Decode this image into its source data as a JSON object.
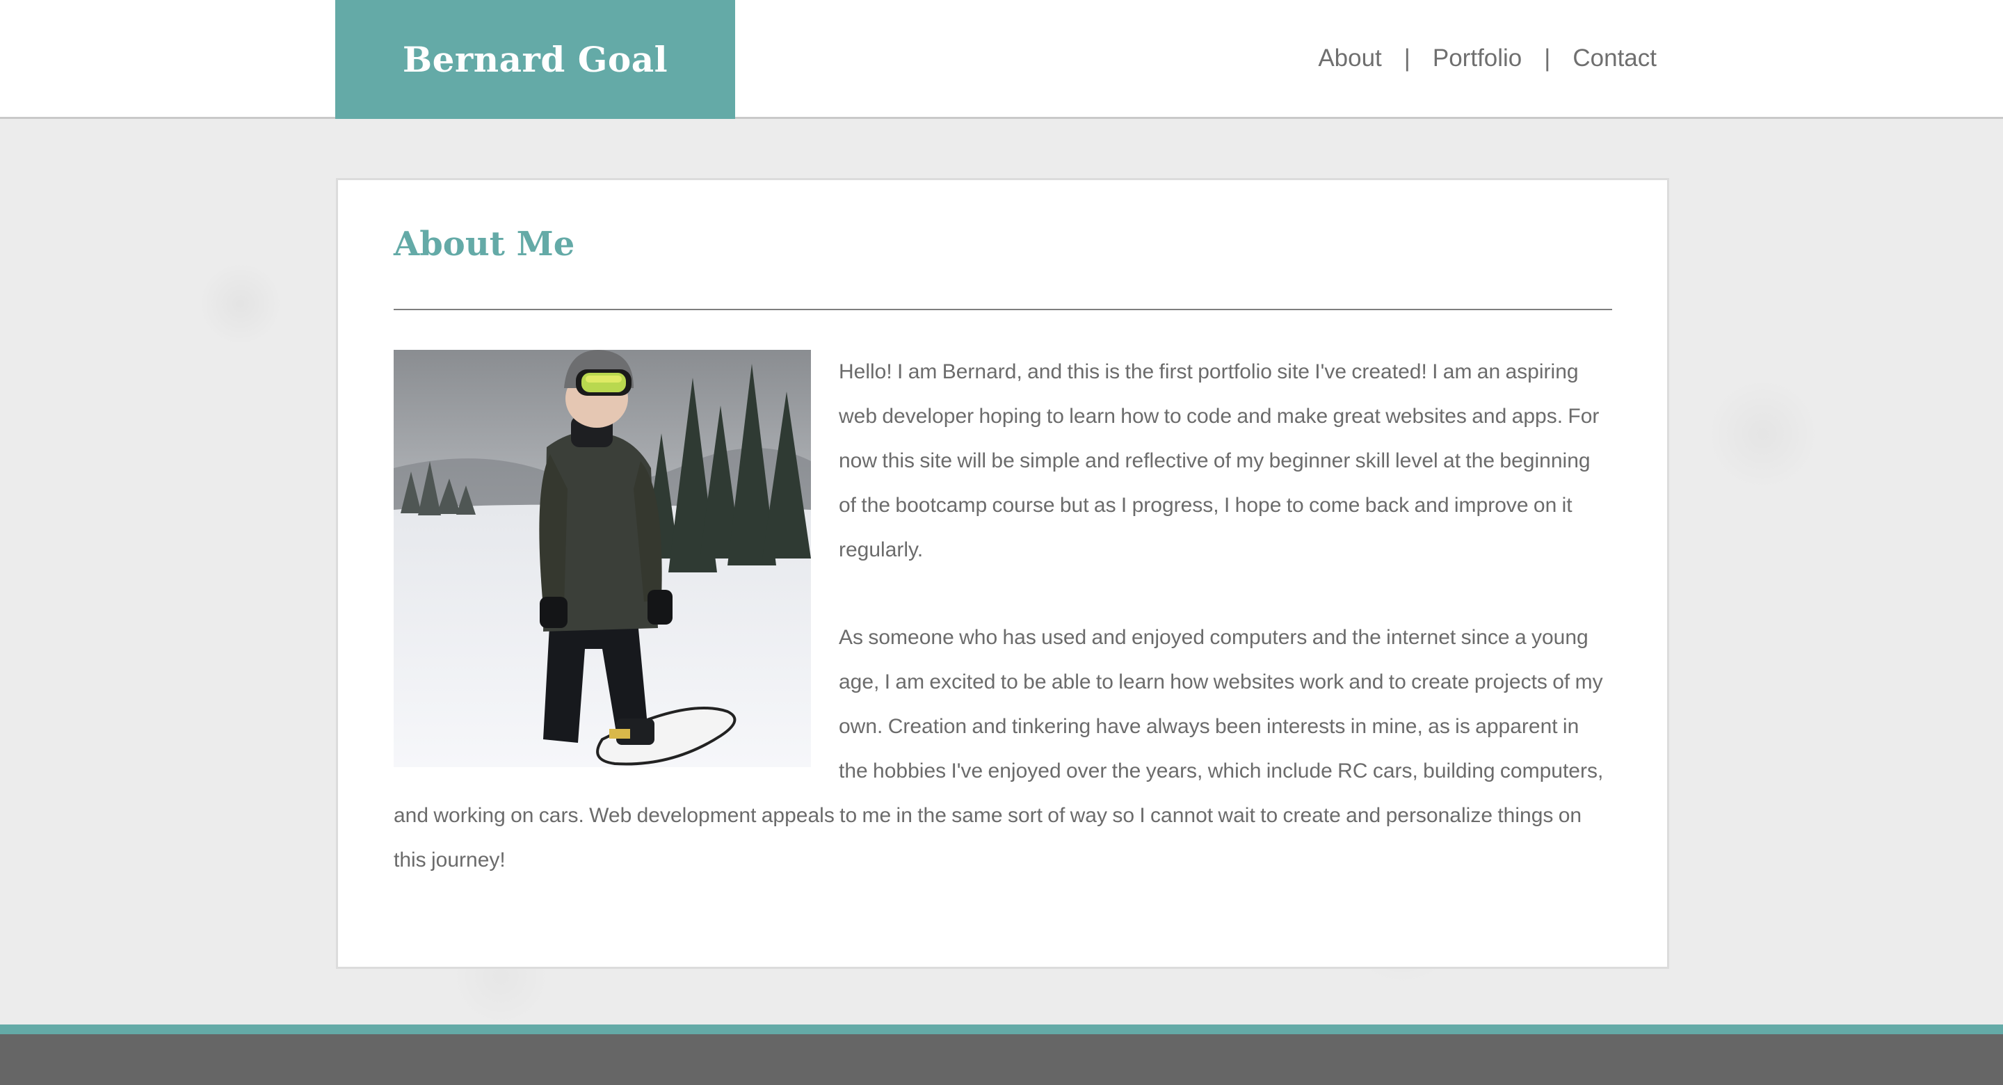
{
  "header": {
    "brand": "Bernard Goal",
    "nav": {
      "about": "About",
      "portfolio": "Portfolio",
      "contact": "Contact",
      "separator": "|"
    }
  },
  "main": {
    "title": "About Me",
    "photo_alt": "Bernard snowboarding on a snowy slope",
    "paragraphs": [
      "Hello! I am Bernard, and this is the first portfolio site I've created! I am an aspiring web developer hoping to learn how to code and make great websites and apps. For now this site will be simple and reflective of my beginner skill level at the beginning of the bootcamp course but as I progress, I hope to come back and improve on it regularly.",
      "As someone who has used and enjoyed computers and the internet since a young age, I am excited to be able to learn how websites work and to create projects of my own. Creation and tinkering have always been interests in mine, as is apparent in the hobbies I've enjoyed over the years, which include RC cars, building computers, and working on cars. Web development appeals to me in the same sort of way so I cannot wait to create and personalize things on this journey!"
    ]
  },
  "colors": {
    "accent": "#64aaa7",
    "text": "#6b6b6b",
    "footer": "#666666",
    "background": "#ececec"
  }
}
